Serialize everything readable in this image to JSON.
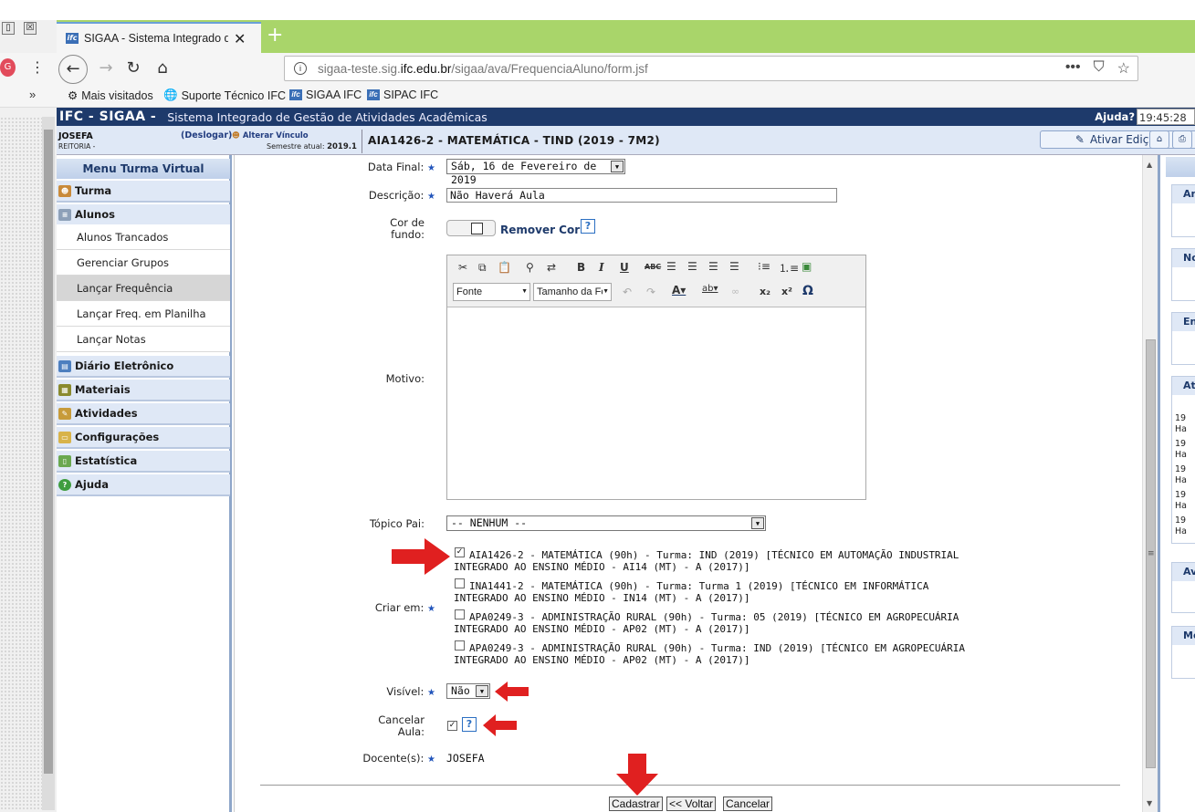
{
  "browser": {
    "tab_title": "SIGAA - Sistema Integrado de G",
    "new_tab": "+",
    "tab_close": "✕",
    "url_prefix": "sigaa-teste.sig.",
    "url_host": "ifc.edu.br",
    "url_path": "/sigaa/ava/FrequenciaAluno/form.jsf",
    "profile_initial": "G",
    "bookmarks_overflow": "»",
    "bookmarks": [
      "Mais visitados",
      "Suporte Técnico IFC",
      "SIGAA IFC",
      "SIPAC IFC"
    ],
    "window_buttons": [
      "▯",
      "☒"
    ]
  },
  "header": {
    "brand": "IFC - SIGAA -",
    "system_name": "Sistema Integrado de Gestão de Atividades Acadêmicas",
    "help": "Ajuda?",
    "clock": "19:45:28",
    "user_name": "JOSEFA",
    "institution": "REITORIA -",
    "logout": "(Deslogar)",
    "change_link": "Alterar Vínculo",
    "semester_label": "Semestre atual:",
    "semester_value": "2019.1",
    "course_title": "AIA1426-2 - MATEMÁTICA - TIND (2019 - 7M2)",
    "edit_button": "Ativar Edição"
  },
  "menu": {
    "title": "Menu Turma Virtual",
    "sections": {
      "turma": "Turma",
      "alunos": "Alunos",
      "diario": "Diário Eletrônico",
      "materiais": "Materiais",
      "atividades": "Atividades",
      "configuracoes": "Configurações",
      "estatistica": "Estatística",
      "ajuda": "Ajuda"
    },
    "alunos_items": [
      "Alunos Trancados",
      "Gerenciar Grupos",
      "Lançar Frequência",
      "Lançar Freq. em Planilha",
      "Lançar Notas"
    ]
  },
  "form": {
    "required_mark": "★",
    "data_final_label": "Data Final:",
    "data_final_value": "Sáb, 16 de Fevereiro de 2019",
    "descricao_label": "Descrição:",
    "descricao_value": "Não Haverá Aula",
    "cor_label_1": "Cor de",
    "cor_label_2": "fundo:",
    "remover_cor": "Remover Cor",
    "motivo_label": "Motivo:",
    "editor_font": "Fonte",
    "editor_size": "Tamanho da Fc",
    "topico_label": "Tópico Pai:",
    "topico_value": "-- NENHUM --",
    "criar_label": "Criar em:",
    "criar_options": [
      {
        "checked": true,
        "line1": "AIA1426-2 - MATEMÁTICA (90h) - Turma: IND (2019) [TÉCNICO EM AUTOMAÇÃO INDUSTRIAL",
        "line2": "INTEGRADO AO ENSINO MÉDIO - AI14 (MT) - A (2017)]"
      },
      {
        "checked": false,
        "line1": "INA1441-2 - MATEMÁTICA (90h) - Turma: Turma 1 (2019) [TÉCNICO EM INFORMÁTICA",
        "line2": "INTEGRADO AO ENSINO MÉDIO - IN14 (MT) - A (2017)]"
      },
      {
        "checked": false,
        "line1": "APA0249-3 - ADMINISTRAÇÃO RURAL (90h) - Turma: 05 (2019) [TÉCNICO EM AGROPECUÁRIA",
        "line2": "INTEGRADO AO ENSINO MÉDIO - AP02 (MT) - A (2017)]"
      },
      {
        "checked": false,
        "line1": "APA0249-3 - ADMINISTRAÇÃO RURAL (90h) - Turma: IND (2019) [TÉCNICO EM AGROPECUÁRIA",
        "line2": "INTEGRADO AO ENSINO MÉDIO - AP02 (MT) - A (2017)]"
      }
    ],
    "visivel_label": "Visível:",
    "visivel_value": "Não",
    "cancelar_label_1": "Cancelar",
    "cancelar_label_2": "Aula:",
    "docentes_label": "Docente(s):",
    "docentes_value": "JOSEFA",
    "help_glyph": "?",
    "checkmark": "✓"
  },
  "buttons": {
    "submit": "Cadastrar",
    "back": "<< Voltar",
    "cancel": "Cancelar"
  },
  "right_panels": [
    "Anúncios",
    "Notícias",
    "Enquetes",
    "Atividades",
    "Avaliações",
    "Mensagens"
  ],
  "right_snippets": [
    "19",
    "Ha",
    "19",
    "Ha",
    "19",
    "Ha",
    "19",
    "Ha",
    "19",
    "Ha"
  ]
}
